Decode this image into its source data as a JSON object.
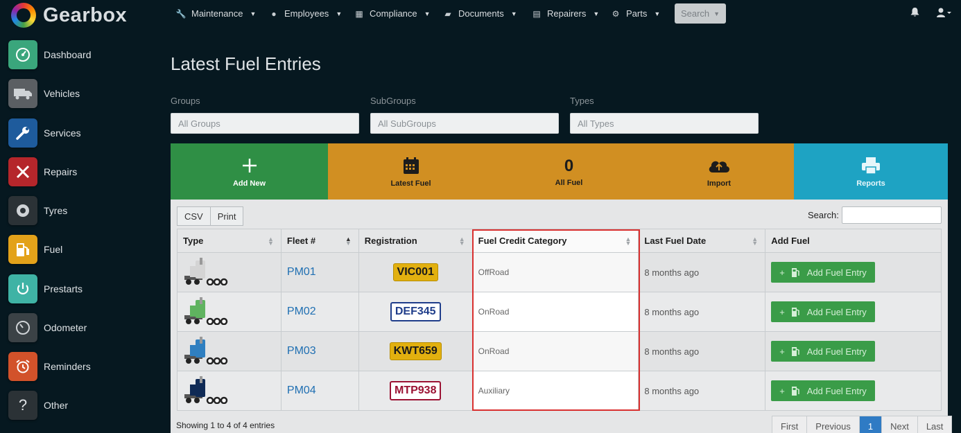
{
  "app": {
    "name": "Gearbox"
  },
  "nav": {
    "items": [
      {
        "label": "Maintenance",
        "icon": "wrench-icon"
      },
      {
        "label": "Employees",
        "icon": "user-circle-icon"
      },
      {
        "label": "Compliance",
        "icon": "calendar-icon"
      },
      {
        "label": "Documents",
        "icon": "folder-icon"
      },
      {
        "label": "Repairers",
        "icon": "address-book-icon"
      },
      {
        "label": "Parts",
        "icon": "gear-icon"
      }
    ],
    "search_label": "Search"
  },
  "sidebar": {
    "items": [
      {
        "label": "Dashboard",
        "icon": "dashboard-icon",
        "color": "#3aa67c"
      },
      {
        "label": "Vehicles",
        "icon": "truck-icon",
        "color": "#5b5f63"
      },
      {
        "label": "Services",
        "icon": "wrench-icon",
        "color": "#1e5b9c"
      },
      {
        "label": "Repairs",
        "icon": "tools-icon",
        "color": "#b5262b"
      },
      {
        "label": "Tyres",
        "icon": "tyre-icon",
        "color": "#2b3236"
      },
      {
        "label": "Fuel",
        "icon": "fuel-pump-icon",
        "color": "#e3a21a"
      },
      {
        "label": "Prestarts",
        "icon": "power-icon",
        "color": "#3fb3a5"
      },
      {
        "label": "Odometer",
        "icon": "gauge-icon",
        "color": "#3b4246"
      },
      {
        "label": "Reminders",
        "icon": "alarm-clock-icon",
        "color": "#d2522a"
      },
      {
        "label": "Other",
        "icon": "question-icon",
        "color": "#2b3236"
      }
    ]
  },
  "page": {
    "title": "Latest Fuel Entries"
  },
  "filters": {
    "groups": {
      "label": "Groups",
      "value": "All Groups"
    },
    "subgroups": {
      "label": "SubGroups",
      "value": "All SubGroups"
    },
    "types": {
      "label": "Types",
      "value": "All Types"
    }
  },
  "actions": {
    "add_new": "Add New",
    "latest_fuel": "Latest Fuel",
    "all_fuel_count": "0",
    "all_fuel": "All Fuel",
    "import": "Import",
    "reports": "Reports"
  },
  "table": {
    "csv": "CSV",
    "print": "Print",
    "search_label": "Search:",
    "columns": [
      "Type",
      "Fleet #",
      "Registration",
      "Fuel Credit Category",
      "Last Fuel Date",
      "Add Fuel"
    ],
    "rows": [
      {
        "truck_color": "#d4d4d4",
        "fleet": "PM01",
        "rego": "VIC001",
        "rego_style": "yellow",
        "category": "OffRoad",
        "last_fuel": "8 months ago",
        "add_label": "Add Fuel Entry"
      },
      {
        "truck_color": "#5fb35f",
        "fleet": "PM02",
        "rego": "DEF345",
        "rego_style": "blue",
        "category": "OnRoad",
        "last_fuel": "8 months ago",
        "add_label": "Add Fuel Entry"
      },
      {
        "truck_color": "#2f7fc0",
        "fleet": "PM03",
        "rego": "KWT659",
        "rego_style": "yellow",
        "category": "OnRoad",
        "last_fuel": "8 months ago",
        "add_label": "Add Fuel Entry"
      },
      {
        "truck_color": "#0f2a55",
        "fleet": "PM04",
        "rego": "MTP938",
        "rego_style": "red",
        "category": "Auxiliary",
        "last_fuel": "8 months ago",
        "add_label": "Add Fuel Entry"
      }
    ],
    "info": "Showing 1 to 4 of 4 entries"
  },
  "pagination": {
    "first": "First",
    "previous": "Previous",
    "current": "1",
    "next": "Next",
    "last": "Last"
  }
}
